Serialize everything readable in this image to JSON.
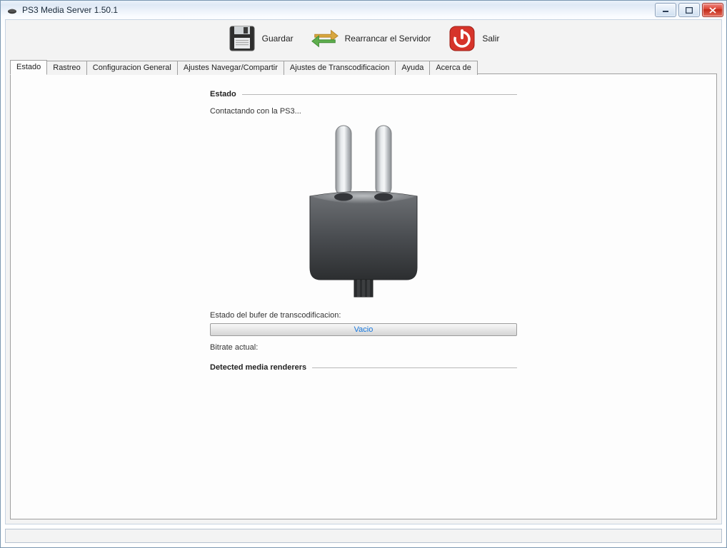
{
  "window": {
    "title": "PS3 Media Server 1.50.1"
  },
  "toolbar": {
    "save": "Guardar",
    "restart": "Rearrancar el Servidor",
    "exit": "Salir"
  },
  "tabs": {
    "items": [
      "Estado",
      "Rastreo",
      "Configuracion General",
      "Ajustes Navegar/Compartir",
      "Ajustes de Transcodificacion",
      "Ayuda",
      "Acerca de"
    ],
    "active_index": 0
  },
  "status": {
    "group_title": "Estado",
    "connecting": "Contactando con la PS3...",
    "buffer_label": "Estado del bufer de transcodificacion:",
    "buffer_value": "Vacio",
    "bitrate_label": "Bitrate actual:",
    "renderers_title": "Detected media renderers"
  }
}
